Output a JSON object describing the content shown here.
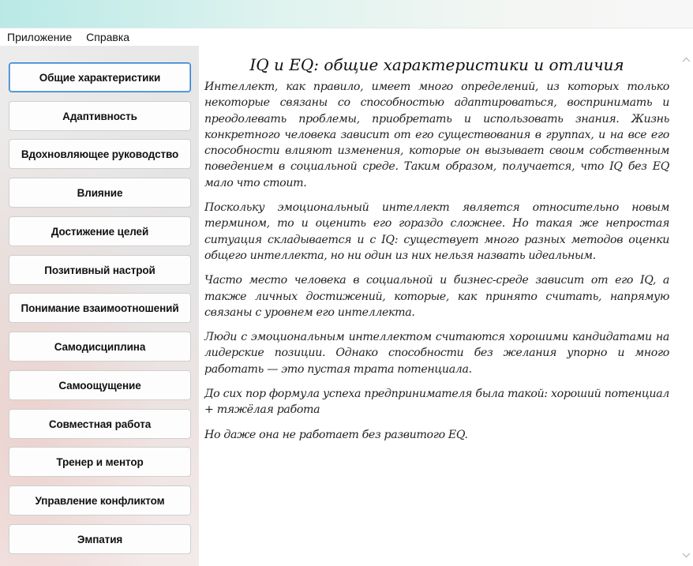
{
  "menu": {
    "items": [
      "Приложение",
      "Справка"
    ]
  },
  "sidebar": {
    "items": [
      {
        "label": "Общие характеристики",
        "active": true
      },
      {
        "label": "Адаптивность"
      },
      {
        "label": "Вдохновляющее руководство"
      },
      {
        "label": "Влияние"
      },
      {
        "label": "Достижение целей"
      },
      {
        "label": "Позитивный настрой"
      },
      {
        "label": "Понимание взаимоотношений"
      },
      {
        "label": "Самодисциплина"
      },
      {
        "label": "Самоощущение"
      },
      {
        "label": "Совместная работа"
      },
      {
        "label": "Тренер и ментор"
      },
      {
        "label": "Управление конфликтом"
      },
      {
        "label": "Эмпатия"
      }
    ]
  },
  "article": {
    "title": "IQ и EQ: общие характеристики и отличия",
    "paragraphs": [
      "Интеллект, как правило, имеет много определений, из которых только некоторые связаны со способностью адаптироваться, воспринимать и преодолевать проблемы, приобретать и использовать знания. Жизнь конкретного человека зависит от его существования в группах, и на все его способности влияют изменения, которые он вызывает своим собственным поведением в социальной среде. Таким образом, получается, что IQ без EQ мало что стоит.",
      "Поскольку эмоциональный интеллект является относительно новым термином, то и оценить его гораздо сложнее. Но такая же непростая ситуация складывается и с IQ: существует много разных методов оценки общего интеллекта, но ни один из них нельзя назвать идеальным.",
      "Часто место человека в социальной и бизнес-среде зависит от его IQ, а также личных достижений, которые, как принято считать, напрямую связаны с уровнем его интеллекта.",
      "Люди с эмоциональным интеллектом считаются хорошими кандидатами на лидерские позиции. Однако способности без желания упорно и много работать — это пустая трата потенциала.",
      "До сих пор формула успеха предпринимателя была такой: хороший потенциал + тяжёлая работа",
      "Но даже она не работает без развитого EQ."
    ]
  },
  "colors": {
    "active_border": "#2f7fd0",
    "titlebar_start": "#b9e9e6"
  }
}
